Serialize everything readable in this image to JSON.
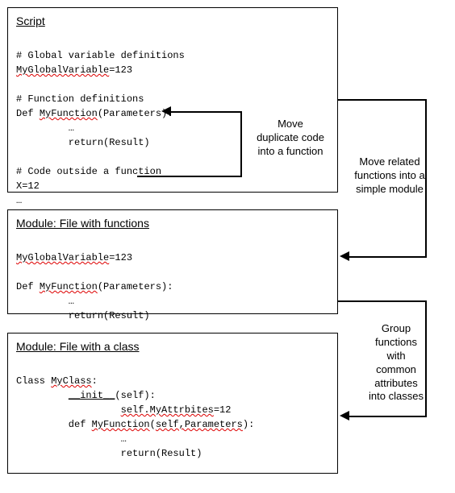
{
  "box1": {
    "title": "Script",
    "comment1": "# Global variable definitions",
    "line_global": "MyGlobalVariable=123",
    "line_global_squig": "MyGlobalVariable",
    "line_global_rest": "=123",
    "comment2": "# Function definitions",
    "line_def_pref": "Def ",
    "line_def_fn": "MyFunction",
    "line_def_rest": "(Parameters):",
    "line_dots": "         …",
    "line_return": "         return(Result)",
    "comment3": "# Code outside a function",
    "line_x": "X=12",
    "line_end": "…"
  },
  "box1_anno": {
    "l1": "Move",
    "l2": "duplicate code",
    "l3": "into a function"
  },
  "right_anno1": {
    "l1": "Move related",
    "l2": "functions into a",
    "l3": "simple module"
  },
  "box2": {
    "title": "Module: File with functions",
    "line_global_squig": "MyGlobalVariable",
    "line_global_rest": "=123",
    "line_def_pref": "Def ",
    "line_def_fn": "MyFunction",
    "line_def_rest": "(Parameters):",
    "line_dots": "         …",
    "line_return": "         return(Result)"
  },
  "right_anno2": {
    "l1": "Group",
    "l2": "functions",
    "l3": "with",
    "l4": "common",
    "l5": "attributes",
    "l6": "into classes"
  },
  "box3": {
    "title": "Module: File with a class",
    "line_class_pref": "Class ",
    "line_class_name": "MyClass",
    "line_class_rest": ":",
    "line_init_pref": "         ",
    "line_init_u": "__init__",
    "line_init_rest": "(self):",
    "line_attr_pref": "                  ",
    "line_attr_u": "self.MyAttrbites",
    "line_attr_rest": "=12",
    "line_def_pref": "         def ",
    "line_def_fn": "MyFunction",
    "line_def_mid": "(",
    "line_def_self": "self,Parameters",
    "line_def_rest": "):",
    "line_dots": "                  …",
    "line_return": "                  return(Result)"
  }
}
